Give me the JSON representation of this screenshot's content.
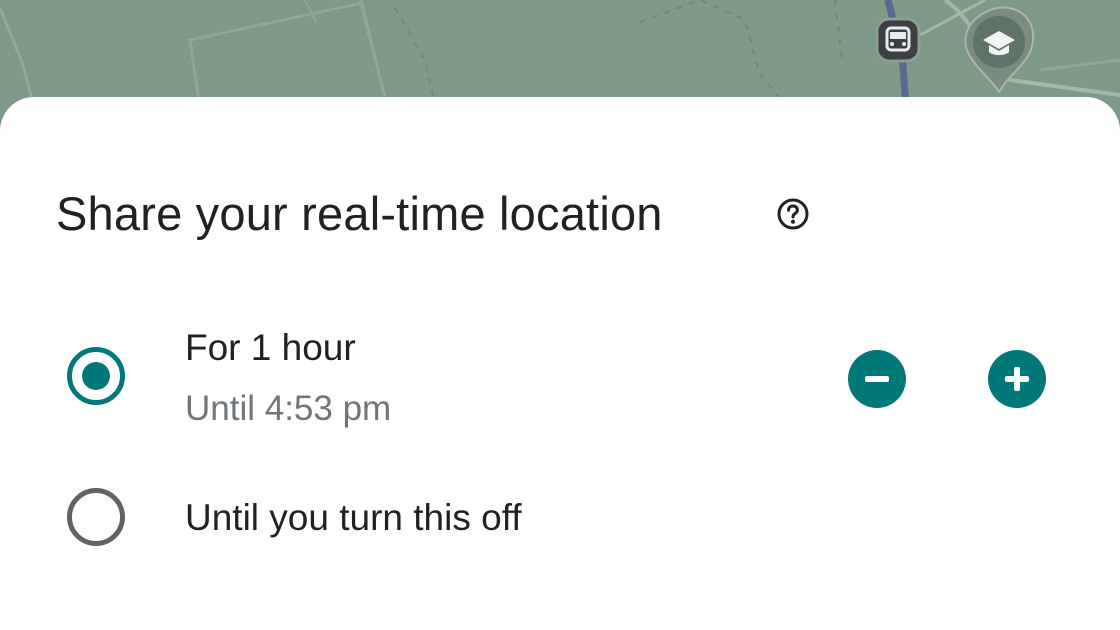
{
  "map": {
    "background_color": "#7d9987",
    "transit_icon": "bus-icon",
    "place_icon": "school-icon"
  },
  "sheet": {
    "title": "Share your real-time location",
    "help_icon": "help-circle-icon",
    "accent_color": "#00787a",
    "options": [
      {
        "label": "For 1 hour",
        "sublabel": "Until 4:53 pm",
        "selected": true
      },
      {
        "label": "Until you turn this off",
        "selected": false
      }
    ],
    "decrease_icon": "minus-circle-icon",
    "increase_icon": "plus-circle-icon"
  }
}
